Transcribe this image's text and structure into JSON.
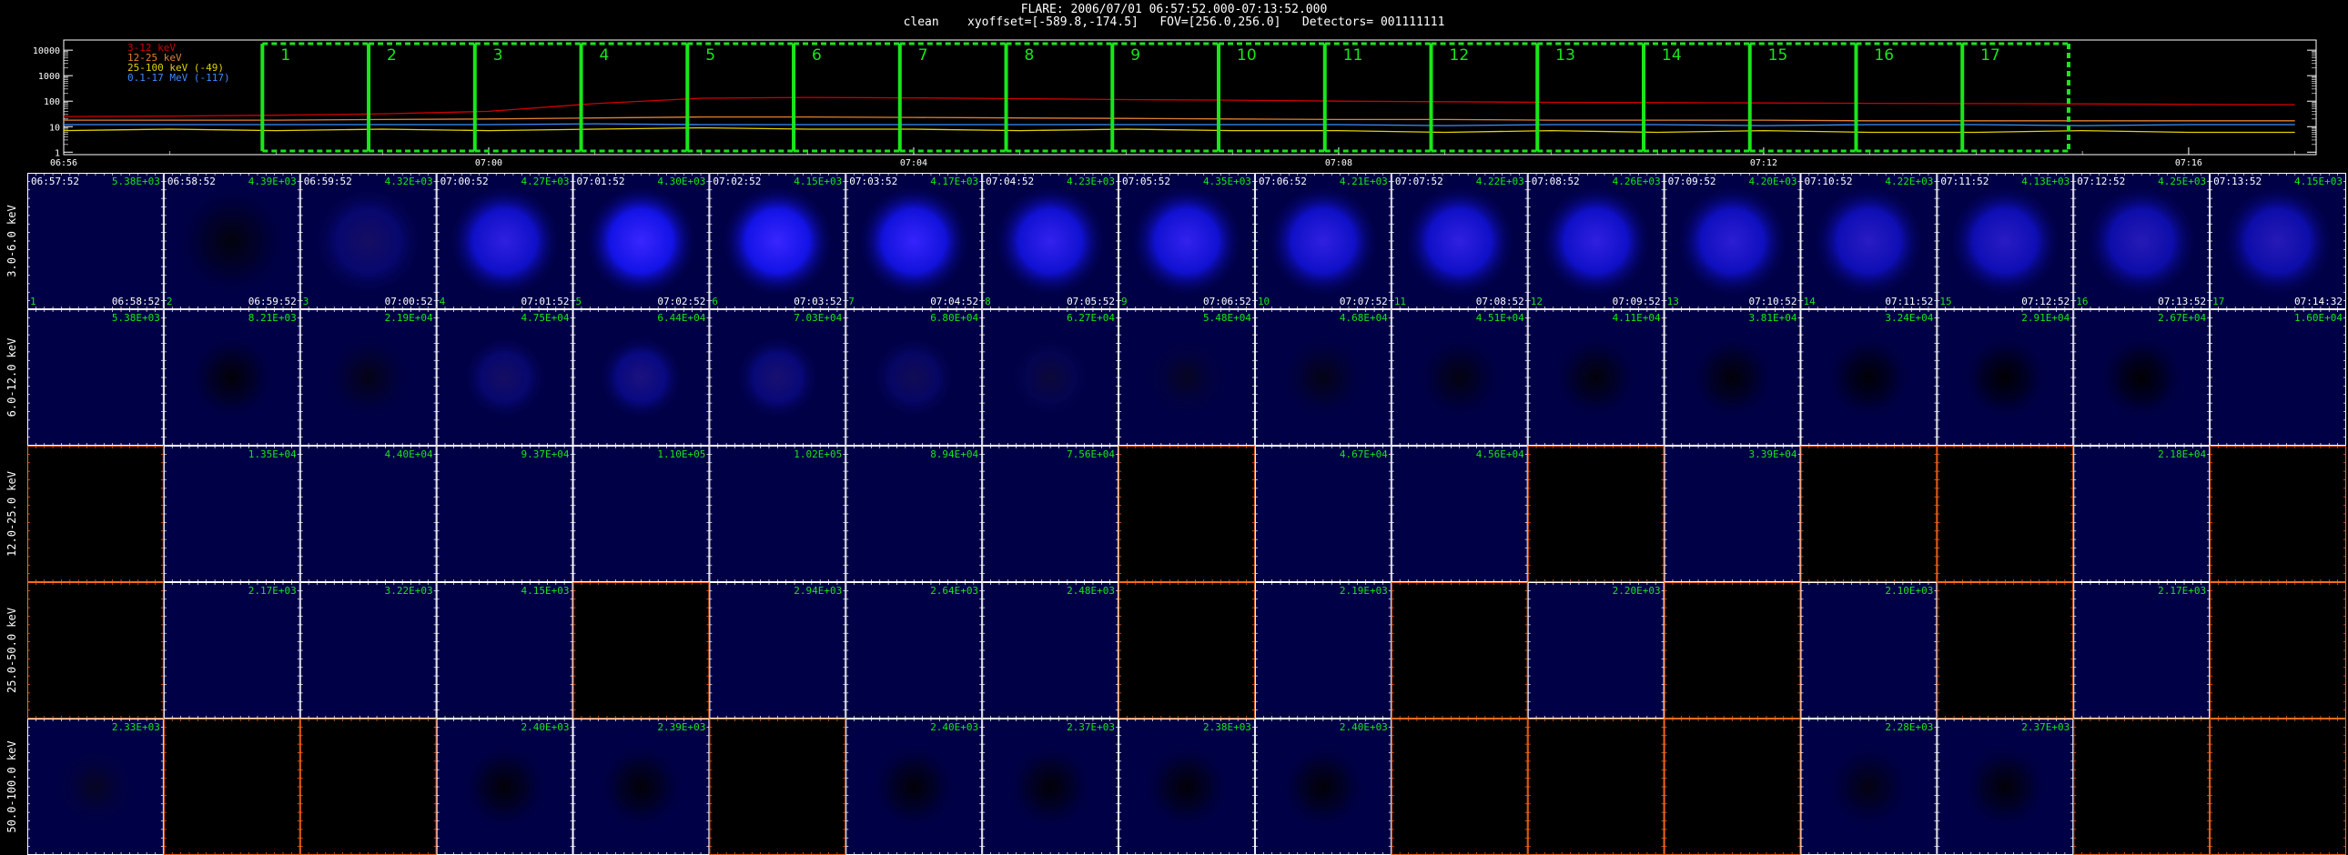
{
  "header": {
    "line1": "FLARE: 2006/07/01 06:57:52.000-07:13:52.000",
    "line2": "clean    xyoffset=[-589.8,-174.5]   FOV=[256.0,256.0]   Detectors= 001111111"
  },
  "colors": {
    "lc_3_12": "#d00000",
    "lc_12_25": "#e08030",
    "lc_25_100": "#e0d000",
    "lc_01_17": "#3a8cff",
    "interval_box": "#19e619",
    "panel_text": "#19e619",
    "panel_border_data": "#ffffff",
    "panel_border_empty": "#ff6a1a"
  },
  "chart_data": [
    {
      "type": "line",
      "title": "",
      "ylabel": "",
      "yscale": "log",
      "ylim": [
        0.8,
        25000
      ],
      "y_ticks": [
        "1",
        "10",
        "100",
        "1000",
        "10000"
      ],
      "x_ticks": [
        "06:56",
        "07:00",
        "07:04",
        "07:08",
        "07:12",
        "07:16"
      ],
      "x_ticks_minutes": [
        0,
        4,
        8,
        12,
        16,
        20
      ],
      "xlim_minutes": [
        0,
        21.2
      ],
      "legend": [
        "3-12 keV",
        "12-25 keV",
        "25-100 keV (-49)",
        "0.1-17 MeV (-117)"
      ],
      "legend_position": "top-left",
      "intervals": [
        "1",
        "2",
        "3",
        "4",
        "5",
        "6",
        "7",
        "8",
        "9",
        "10",
        "11",
        "12",
        "13",
        "14",
        "15",
        "16",
        "17"
      ],
      "interval_start_minute": 1.87,
      "interval_length_minutes": 1,
      "series_minutes": [
        0,
        1,
        2,
        3,
        4,
        5,
        6,
        7,
        8,
        9,
        10,
        11,
        12,
        13,
        14,
        15,
        16,
        17,
        18,
        19,
        20,
        21
      ],
      "series": [
        {
          "name": "3-12 keV",
          "values": [
            25,
            26,
            28,
            32,
            40,
            80,
            130,
            140,
            135,
            125,
            115,
            110,
            100,
            95,
            90,
            88,
            85,
            82,
            80,
            78,
            75,
            72
          ]
        },
        {
          "name": "12-25 keV",
          "values": [
            18,
            18,
            18,
            19,
            20,
            22,
            24,
            24,
            23,
            22,
            21,
            20,
            19,
            19,
            18,
            18,
            18,
            17,
            17,
            17,
            17,
            17
          ]
        },
        {
          "name": "25-100 keV (-49)",
          "values": [
            7,
            8,
            7,
            8,
            7,
            8,
            9,
            8,
            8,
            7,
            8,
            7,
            7,
            6,
            7,
            6,
            7,
            6,
            6,
            7,
            6,
            6
          ]
        },
        {
          "name": "0.1-17 MeV (-117)",
          "values": [
            12,
            12,
            12,
            12,
            12,
            13,
            12,
            12,
            12,
            12,
            12,
            12,
            12,
            11,
            12,
            12,
            11,
            12,
            12,
            11,
            12,
            12
          ]
        }
      ]
    },
    {
      "type": "heatmap",
      "title": "",
      "columns": 17,
      "row_labels": [
        "3.0-6.0 keV",
        "6.0-12.0 keV",
        "12.0-25.0 keV",
        "25.0-50.0 keV",
        "50.0-100.0 keV"
      ],
      "start_times": [
        "06:57:52",
        "06:58:52",
        "06:59:52",
        "07:00:52",
        "07:01:52",
        "07:02:52",
        "07:03:52",
        "07:04:52",
        "07:05:52",
        "07:06:52",
        "07:07:52",
        "07:08:52",
        "07:09:52",
        "07:10:52",
        "07:11:52",
        "07:12:52",
        "07:13:52"
      ],
      "end_times": [
        "06:58:52",
        "06:59:52",
        "07:00:52",
        "07:01:52",
        "07:02:52",
        "07:03:52",
        "07:04:52",
        "07:05:52",
        "07:06:52",
        "07:07:52",
        "07:08:52",
        "07:09:52",
        "07:10:52",
        "07:11:52",
        "07:12:52",
        "07:13:52",
        "07:14:32"
      ],
      "panel_numbers": [
        "1",
        "2",
        "3",
        "4",
        "5",
        "6",
        "7",
        "8",
        "9",
        "10",
        "11",
        "12",
        "13",
        "14",
        "15",
        "16",
        "17"
      ],
      "peaks": [
        [
          "5.38E+03",
          "4.39E+03",
          "4.32E+03",
          "4.27E+03",
          "4.30E+03",
          "4.15E+03",
          "4.17E+03",
          "4.23E+03",
          "4.35E+03",
          "4.21E+03",
          "4.22E+03",
          "4.26E+03",
          "4.20E+03",
          "4.22E+03",
          "4.13E+03",
          "4.25E+03",
          "4.15E+03"
        ],
        [
          "5.38E+03",
          "8.21E+03",
          "2.19E+04",
          "4.75E+04",
          "6.44E+04",
          "7.03E+04",
          "6.80E+04",
          "6.27E+04",
          "5.48E+04",
          "4.68E+04",
          "4.51E+04",
          "4.11E+04",
          "3.81E+04",
          "3.24E+04",
          "2.91E+04",
          "2.67E+04",
          "1.60E+04"
        ],
        [
          "",
          "1.35E+04",
          "4.40E+04",
          "9.37E+04",
          "1.10E+05",
          "1.02E+05",
          "8.94E+04",
          "7.56E+04",
          "",
          "4.67E+04",
          "4.56E+04",
          "",
          "3.39E+04",
          "",
          "",
          "2.18E+04",
          ""
        ],
        [
          "",
          "2.17E+03",
          "3.22E+03",
          "4.15E+03",
          "",
          "2.94E+03",
          "2.64E+03",
          "2.48E+03",
          "",
          "2.19E+03",
          "",
          "2.20E+03",
          "",
          "2.10E+03",
          "",
          "2.17E+03",
          ""
        ],
        [
          "2.33E+03",
          "",
          "",
          "2.40E+03",
          "2.39E+03",
          "",
          "2.40E+03",
          "2.37E+03",
          "2.38E+03",
          "2.40E+03",
          "",
          "",
          "",
          "2.28E+03",
          "2.37E+03",
          "",
          ""
        ]
      ],
      "brightness": [
        [
          0,
          0.05,
          0.35,
          0.8,
          0.95,
          0.95,
          0.9,
          0.85,
          0.85,
          0.8,
          0.8,
          0.8,
          0.75,
          0.7,
          0.7,
          0.65,
          0.65
        ],
        [
          0,
          0.03,
          0.08,
          0.35,
          0.45,
          0.4,
          0.3,
          0.2,
          0.12,
          0.08,
          0.06,
          0.04,
          0.03,
          0.02,
          0.01,
          0.01,
          0
        ],
        [
          0,
          0,
          0,
          0,
          0,
          0,
          0,
          0,
          0,
          0,
          0,
          0,
          0,
          0,
          0,
          0,
          0
        ],
        [
          0,
          0,
          0,
          0,
          0,
          0,
          0,
          0,
          0,
          0,
          0,
          0,
          0,
          0,
          0,
          0,
          0
        ],
        [
          0.12,
          0,
          0,
          0.03,
          0.03,
          0,
          0.03,
          0.03,
          0.03,
          0.03,
          0,
          0,
          0,
          0.06,
          0.03,
          0,
          0
        ]
      ]
    }
  ]
}
